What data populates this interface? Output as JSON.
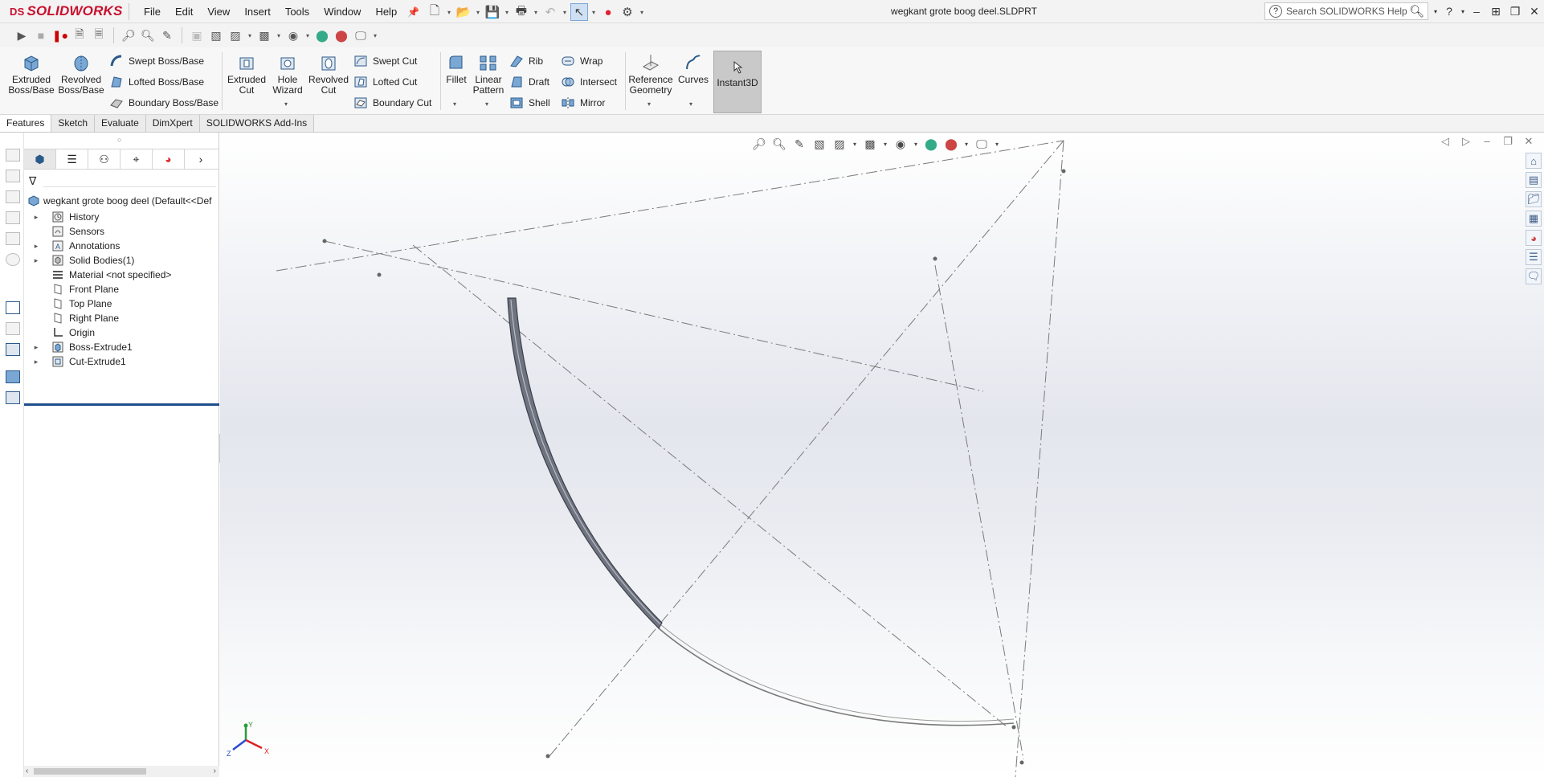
{
  "app": {
    "brand": "SOLIDWORKS",
    "brand_prefix": "DS",
    "document_title": "wegkant grote boog deel.SLDPRT",
    "search_placeholder": "Search SOLIDWORKS Help"
  },
  "menu": [
    "File",
    "Edit",
    "View",
    "Insert",
    "Tools",
    "Window",
    "Help"
  ],
  "ribbon": {
    "extruded_boss": [
      "Extruded",
      "Boss/Base"
    ],
    "revolved_boss": [
      "Revolved",
      "Boss/Base"
    ],
    "swept_boss": "Swept Boss/Base",
    "lofted_boss": "Lofted Boss/Base",
    "boundary_boss": "Boundary Boss/Base",
    "extruded_cut": [
      "Extruded",
      "Cut"
    ],
    "hole_wizard": [
      "Hole",
      "Wizard"
    ],
    "revolved_cut": [
      "Revolved",
      "Cut"
    ],
    "swept_cut": "Swept Cut",
    "lofted_cut": "Lofted Cut",
    "boundary_cut": "Boundary Cut",
    "fillet": "Fillet",
    "linear_pattern": [
      "Linear",
      "Pattern"
    ],
    "rib": "Rib",
    "draft": "Draft",
    "shell": "Shell",
    "wrap": "Wrap",
    "intersect": "Intersect",
    "mirror": "Mirror",
    "reference_geometry": [
      "Reference",
      "Geometry"
    ],
    "curves": "Curves",
    "instant3d": "Instant3D"
  },
  "tabs": [
    "Features",
    "Sketch",
    "Evaluate",
    "DimXpert",
    "SOLIDWORKS Add-Ins"
  ],
  "feature_tree": {
    "root": "wegkant grote boog deel  (Default<<Def",
    "items": [
      {
        "label": "History",
        "expandable": true,
        "icon": "history-icon"
      },
      {
        "label": "Sensors",
        "expandable": false,
        "icon": "sensors-icon"
      },
      {
        "label": "Annotations",
        "expandable": true,
        "icon": "annotations-icon"
      },
      {
        "label": "Solid Bodies(1)",
        "expandable": true,
        "icon": "solid-bodies-icon"
      },
      {
        "label": "Material <not specified>",
        "expandable": false,
        "icon": "material-icon"
      },
      {
        "label": "Front Plane",
        "expandable": false,
        "icon": "plane-icon"
      },
      {
        "label": "Top Plane",
        "expandable": false,
        "icon": "plane-icon"
      },
      {
        "label": "Right Plane",
        "expandable": false,
        "icon": "plane-icon"
      },
      {
        "label": "Origin",
        "expandable": false,
        "icon": "origin-icon"
      },
      {
        "label": "Boss-Extrude1",
        "expandable": true,
        "icon": "boss-extrude-icon"
      },
      {
        "label": "Cut-Extrude1",
        "expandable": true,
        "icon": "cut-extrude-icon"
      }
    ]
  },
  "triad": {
    "x": "X",
    "y": "Y",
    "z": "Z"
  },
  "colors": {
    "brand": "#c8102e",
    "accent": "#1f4e8c",
    "instant3d_active": "#c9c9c9"
  }
}
